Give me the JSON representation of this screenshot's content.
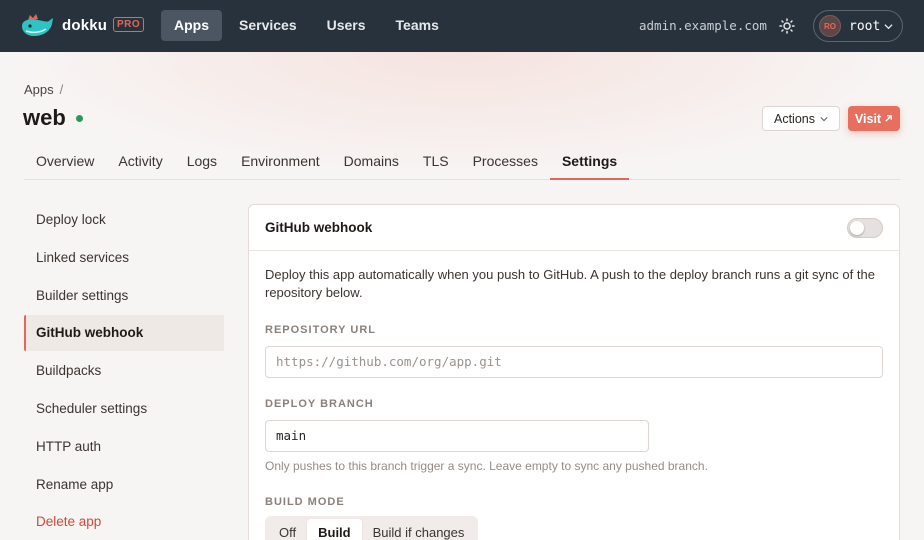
{
  "topbar": {
    "brand": "dokku",
    "badge": "PRO",
    "nav": [
      "Apps",
      "Services",
      "Users",
      "Teams"
    ],
    "active_nav": "Apps",
    "host": "admin.example.com",
    "user": {
      "initials": "RO",
      "name": "root"
    }
  },
  "header": {
    "breadcrumb": "Apps",
    "breadcrumb_sep": "/",
    "app_name": "web",
    "status": "running",
    "actions_label": "Actions",
    "visit_label": "Visit"
  },
  "tabs": [
    "Overview",
    "Activity",
    "Logs",
    "Environment",
    "Domains",
    "TLS",
    "Processes",
    "Settings"
  ],
  "active_tab": "Settings",
  "sidebar": {
    "items": [
      "Deploy lock",
      "Linked services",
      "Builder settings",
      "GitHub webhook",
      "Buildpacks",
      "Scheduler settings",
      "HTTP auth",
      "Rename app",
      "Delete app"
    ],
    "active": "GitHub webhook"
  },
  "panel": {
    "title": "GitHub webhook",
    "enabled": false,
    "description": "Deploy this app automatically when you push to GitHub. A push to the deploy branch runs a git sync of the repository below.",
    "repo_label": "REPOSITORY URL",
    "repo_placeholder": "https://github.com/org/app.git",
    "branch_label": "DEPLOY BRANCH",
    "branch_value": "main",
    "branch_hint": "Only pushes to this branch trigger a sync. Leave empty to sync any pushed branch.",
    "build_mode_label": "BUILD MODE",
    "build_modes": [
      "Off",
      "Build",
      "Build if changes"
    ],
    "build_mode_selected": "Build"
  },
  "colors": {
    "accent": "#e0685b",
    "topbar": "#27323d",
    "status_ok": "#2a9a5a"
  }
}
